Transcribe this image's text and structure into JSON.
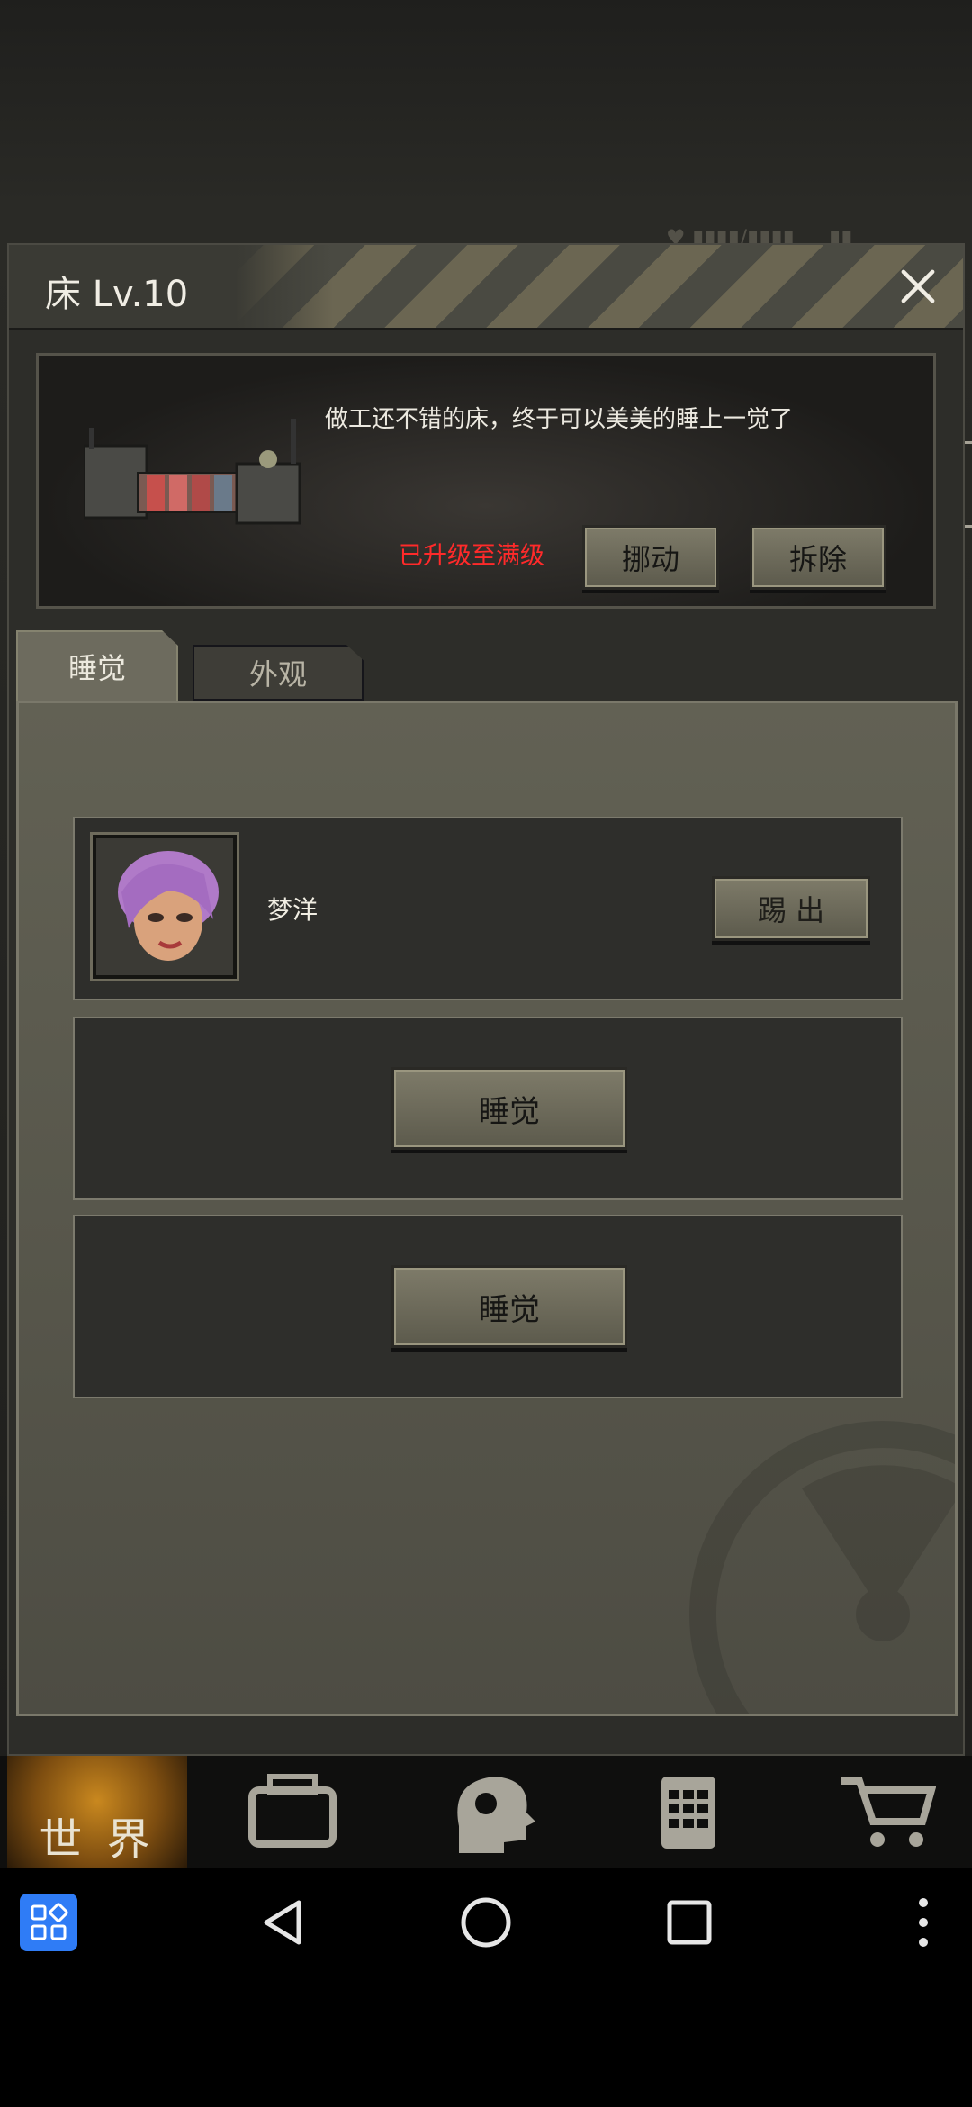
{
  "dialog": {
    "title": "床 Lv.10"
  },
  "info": {
    "description": "做工还不错的床，终于可以美美的睡上一觉了",
    "status": "已升级至满级",
    "move_label": "挪动",
    "remove_label": "拆除"
  },
  "tabs": [
    {
      "label": "睡觉",
      "active": true
    },
    {
      "label": "外观",
      "active": false
    }
  ],
  "slots": [
    {
      "type": "occupied",
      "character_name": "梦洋",
      "kick_label": "踢 出"
    },
    {
      "type": "empty",
      "action_label": "睡觉"
    },
    {
      "type": "empty",
      "action_label": "睡觉"
    }
  ],
  "bottom_nav": {
    "world_label": "世 界",
    "items": [
      "backpack-icon",
      "head-gear-icon",
      "calculator-icon",
      "cart-icon"
    ]
  },
  "colors": {
    "status_red": "#ff2a2a",
    "button_fill": "#7e7b69",
    "panel_bg": "#2d2d29",
    "system_apps_blue": "#2f7cf6"
  }
}
